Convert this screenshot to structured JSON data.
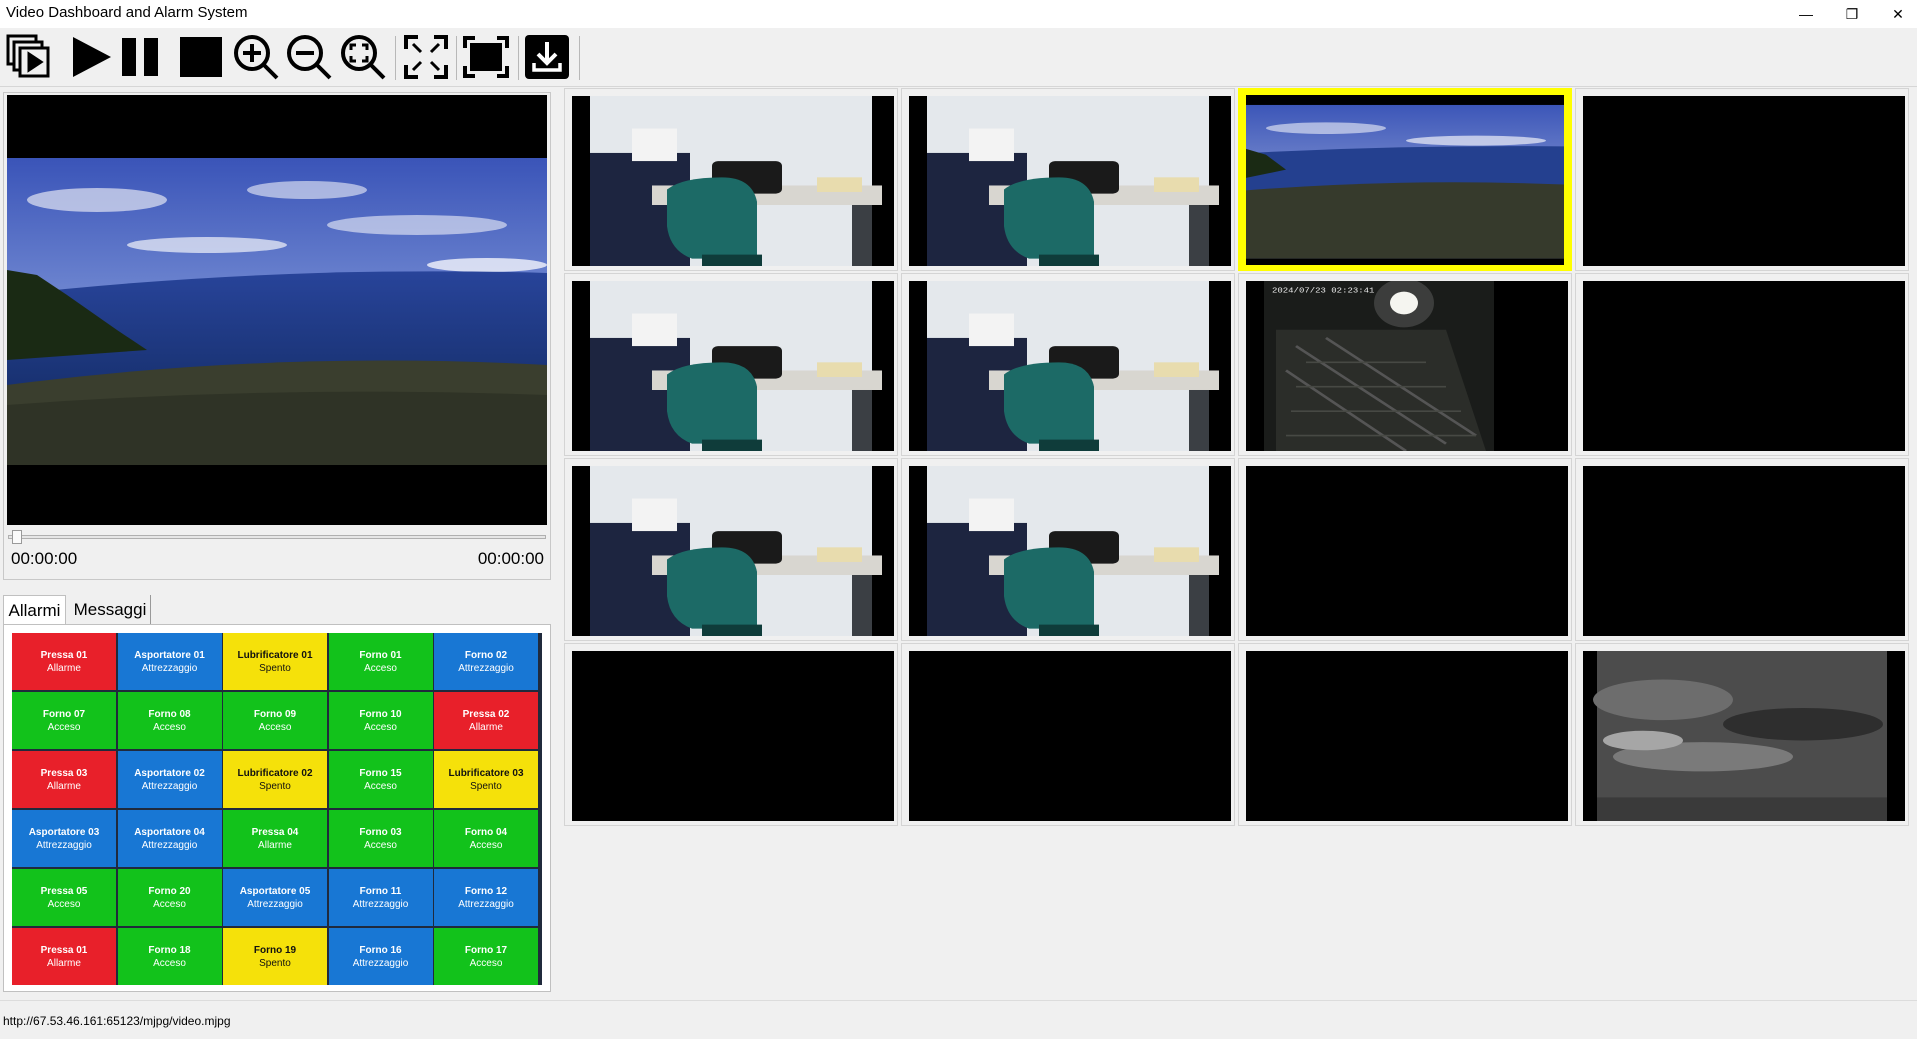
{
  "window": {
    "title": "Video Dashboard and Alarm System"
  },
  "toolbar": {
    "buttons": [
      {
        "name": "multi-view-icon"
      },
      {
        "name": "play-icon"
      },
      {
        "name": "pause-icon"
      },
      {
        "name": "stop-icon"
      },
      {
        "name": "zoom-in-icon"
      },
      {
        "name": "zoom-out-icon"
      },
      {
        "name": "zoom-fit-icon"
      },
      {
        "name": "expand-icon"
      },
      {
        "name": "fullscreen-icon"
      },
      {
        "name": "download-icon"
      }
    ]
  },
  "player": {
    "elapsed": "00:00:00",
    "duration": "00:00:00",
    "progress": 0
  },
  "tabs": {
    "alarms": "Allarmi",
    "messages": "Messaggi"
  },
  "colors": {
    "red": "#e8202a",
    "blue": "#1877d4",
    "yellow": "#f5e10a",
    "green": "#12c21b",
    "selected": "#ffff00"
  },
  "alarms": [
    {
      "name": "Pressa 01",
      "state": "Allarme",
      "color": "red"
    },
    {
      "name": "Asportatore 01",
      "state": "Attrezzaggio",
      "color": "blue"
    },
    {
      "name": "Lubrificatore 01",
      "state": "Spento",
      "color": "yellow"
    },
    {
      "name": "Forno 01",
      "state": "Acceso",
      "color": "green"
    },
    {
      "name": "Forno 02",
      "state": "Attrezzaggio",
      "color": "blue"
    },
    {
      "name": "Forno 07",
      "state": "Acceso",
      "color": "green"
    },
    {
      "name": "Forno 08",
      "state": "Acceso",
      "color": "green"
    },
    {
      "name": "Forno 09",
      "state": "Acceso",
      "color": "green"
    },
    {
      "name": "Forno 10",
      "state": "Acceso",
      "color": "green"
    },
    {
      "name": "Pressa 02",
      "state": "Allarme",
      "color": "red"
    },
    {
      "name": "Pressa 03",
      "state": "Allarme",
      "color": "red"
    },
    {
      "name": "Asportatore 02",
      "state": "Attrezzaggio",
      "color": "blue"
    },
    {
      "name": "Lubrificatore 02",
      "state": "Spento",
      "color": "yellow"
    },
    {
      "name": "Forno 15",
      "state": "Acceso",
      "color": "green"
    },
    {
      "name": "Lubrificatore 03",
      "state": "Spento",
      "color": "yellow"
    },
    {
      "name": "Asportatore 03",
      "state": "Attrezzaggio",
      "color": "blue"
    },
    {
      "name": "Asportatore 04",
      "state": "Attrezzaggio",
      "color": "blue"
    },
    {
      "name": "Pressa 04",
      "state": "Allarme",
      "color": "green"
    },
    {
      "name": "Forno 03",
      "state": "Acceso",
      "color": "green"
    },
    {
      "name": "Forno 04",
      "state": "Acceso",
      "color": "green"
    },
    {
      "name": "Pressa 05",
      "state": "Acceso",
      "color": "green"
    },
    {
      "name": "Forno 20",
      "state": "Acceso",
      "color": "green"
    },
    {
      "name": "Asportatore 05",
      "state": "Attrezzaggio",
      "color": "blue"
    },
    {
      "name": "Forno 11",
      "state": "Attrezzaggio",
      "color": "blue"
    },
    {
      "name": "Forno 12",
      "state": "Attrezzaggio",
      "color": "blue"
    },
    {
      "name": "Pressa 01",
      "state": "Allarme",
      "color": "red"
    },
    {
      "name": "Forno 18",
      "state": "Acceso",
      "color": "green"
    },
    {
      "name": "Forno 19",
      "state": "Spento",
      "color": "yellow"
    },
    {
      "name": "Forno 16",
      "state": "Attrezzaggio",
      "color": "blue"
    },
    {
      "name": "Forno 17",
      "state": "Acceso",
      "color": "green"
    }
  ],
  "cameras": [
    {
      "feed": "office"
    },
    {
      "feed": "office"
    },
    {
      "feed": "ocean",
      "selected": true
    },
    {
      "feed": "none"
    },
    {
      "feed": "office"
    },
    {
      "feed": "office"
    },
    {
      "feed": "night",
      "timestamp": "2024/07/23  02:23:41"
    },
    {
      "feed": "none"
    },
    {
      "feed": "office"
    },
    {
      "feed": "office"
    },
    {
      "feed": "none"
    },
    {
      "feed": "none"
    },
    {
      "feed": "none"
    },
    {
      "feed": "none"
    },
    {
      "feed": "none"
    },
    {
      "feed": "sky"
    }
  ],
  "status": {
    "url": "http://67.53.46.161:65123/mjpg/video.mjpg"
  }
}
